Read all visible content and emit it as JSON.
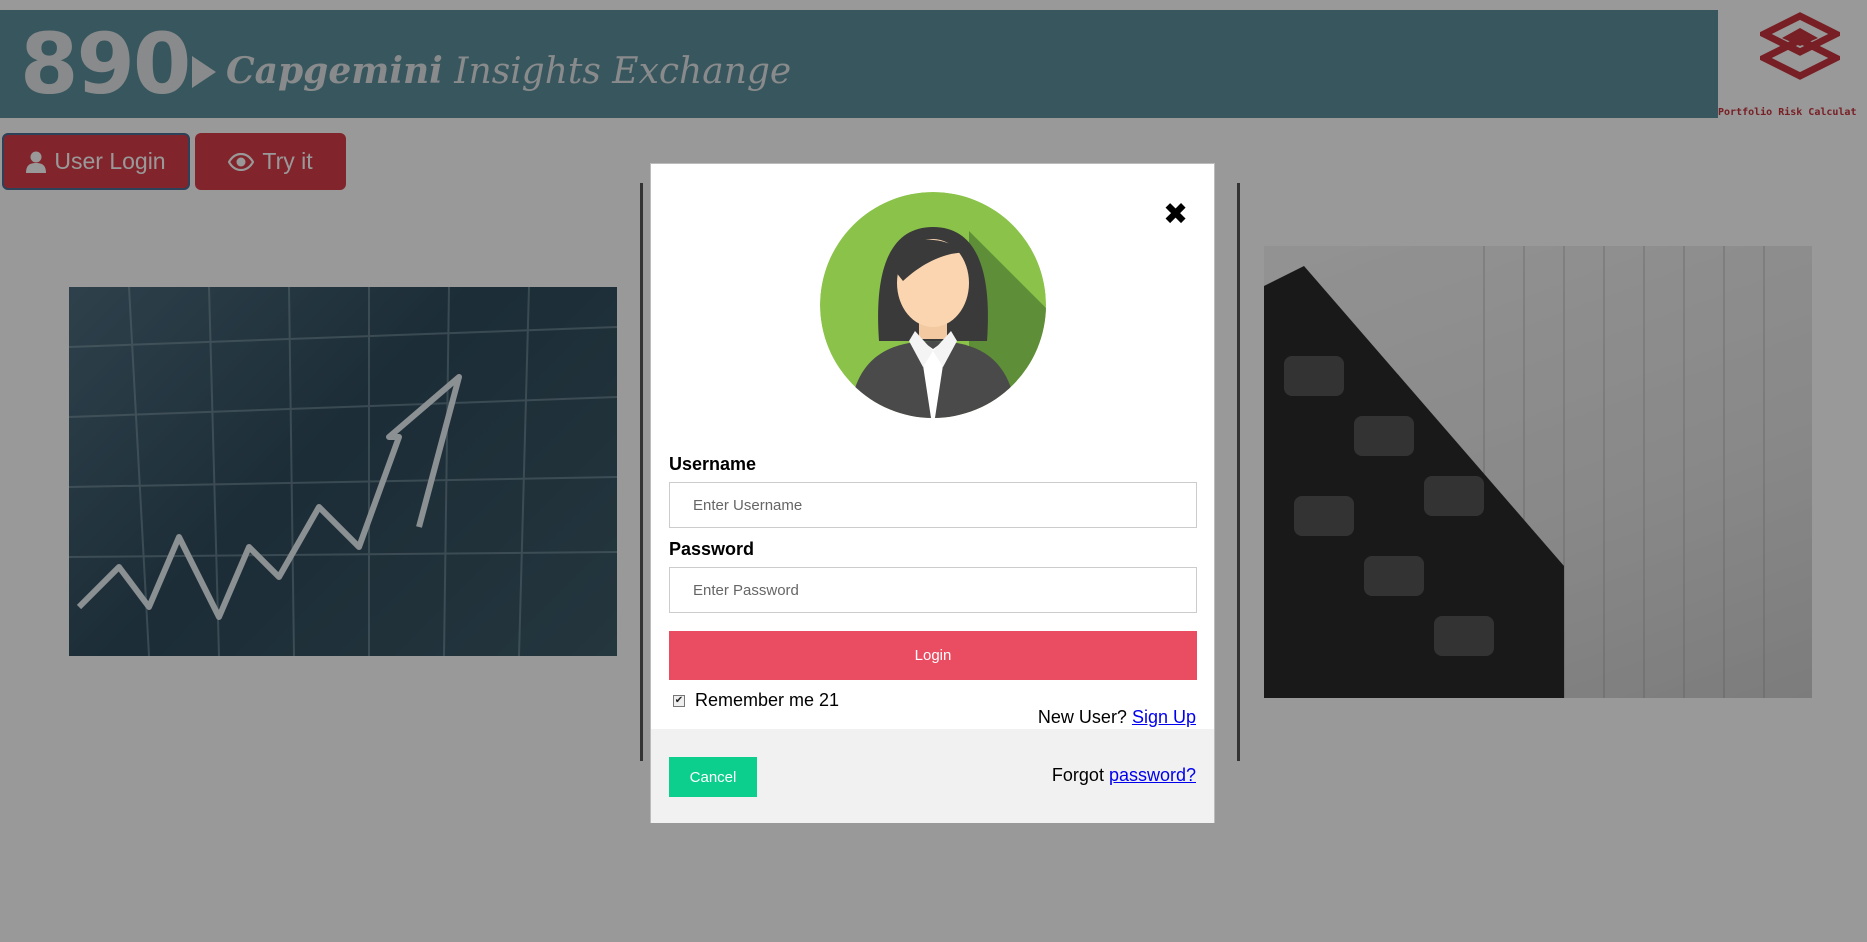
{
  "header": {
    "number": "890",
    "brand_bold": "Capgemini",
    "brand_rest": " Insights Exchange",
    "corner_label": "Portfolio Risk Calculat"
  },
  "nav": {
    "user_login_label": "User Login",
    "try_it_label": "Try it"
  },
  "modal": {
    "username_label": "Username",
    "username_placeholder": "Enter Username",
    "password_label": "Password",
    "password_placeholder": "Enter Password",
    "login_label": "Login",
    "remember_label": "Remember me 21",
    "remember_checked": true,
    "new_user_text": "New User? ",
    "sign_up_label": "Sign Up",
    "cancel_label": "Cancel",
    "forgot_text": "Forgot ",
    "forgot_link": "password?"
  },
  "colors": {
    "banner": "#5d8f9b",
    "accent_red": "#d93c4a",
    "login_button": "#ea4c62",
    "cancel_button": "#0ccf8d",
    "avatar_bg": "#8bc34a"
  },
  "icons": {
    "close": "close-icon",
    "user": "user-icon",
    "eye": "eye-icon",
    "avatar": "businesswoman-avatar"
  }
}
